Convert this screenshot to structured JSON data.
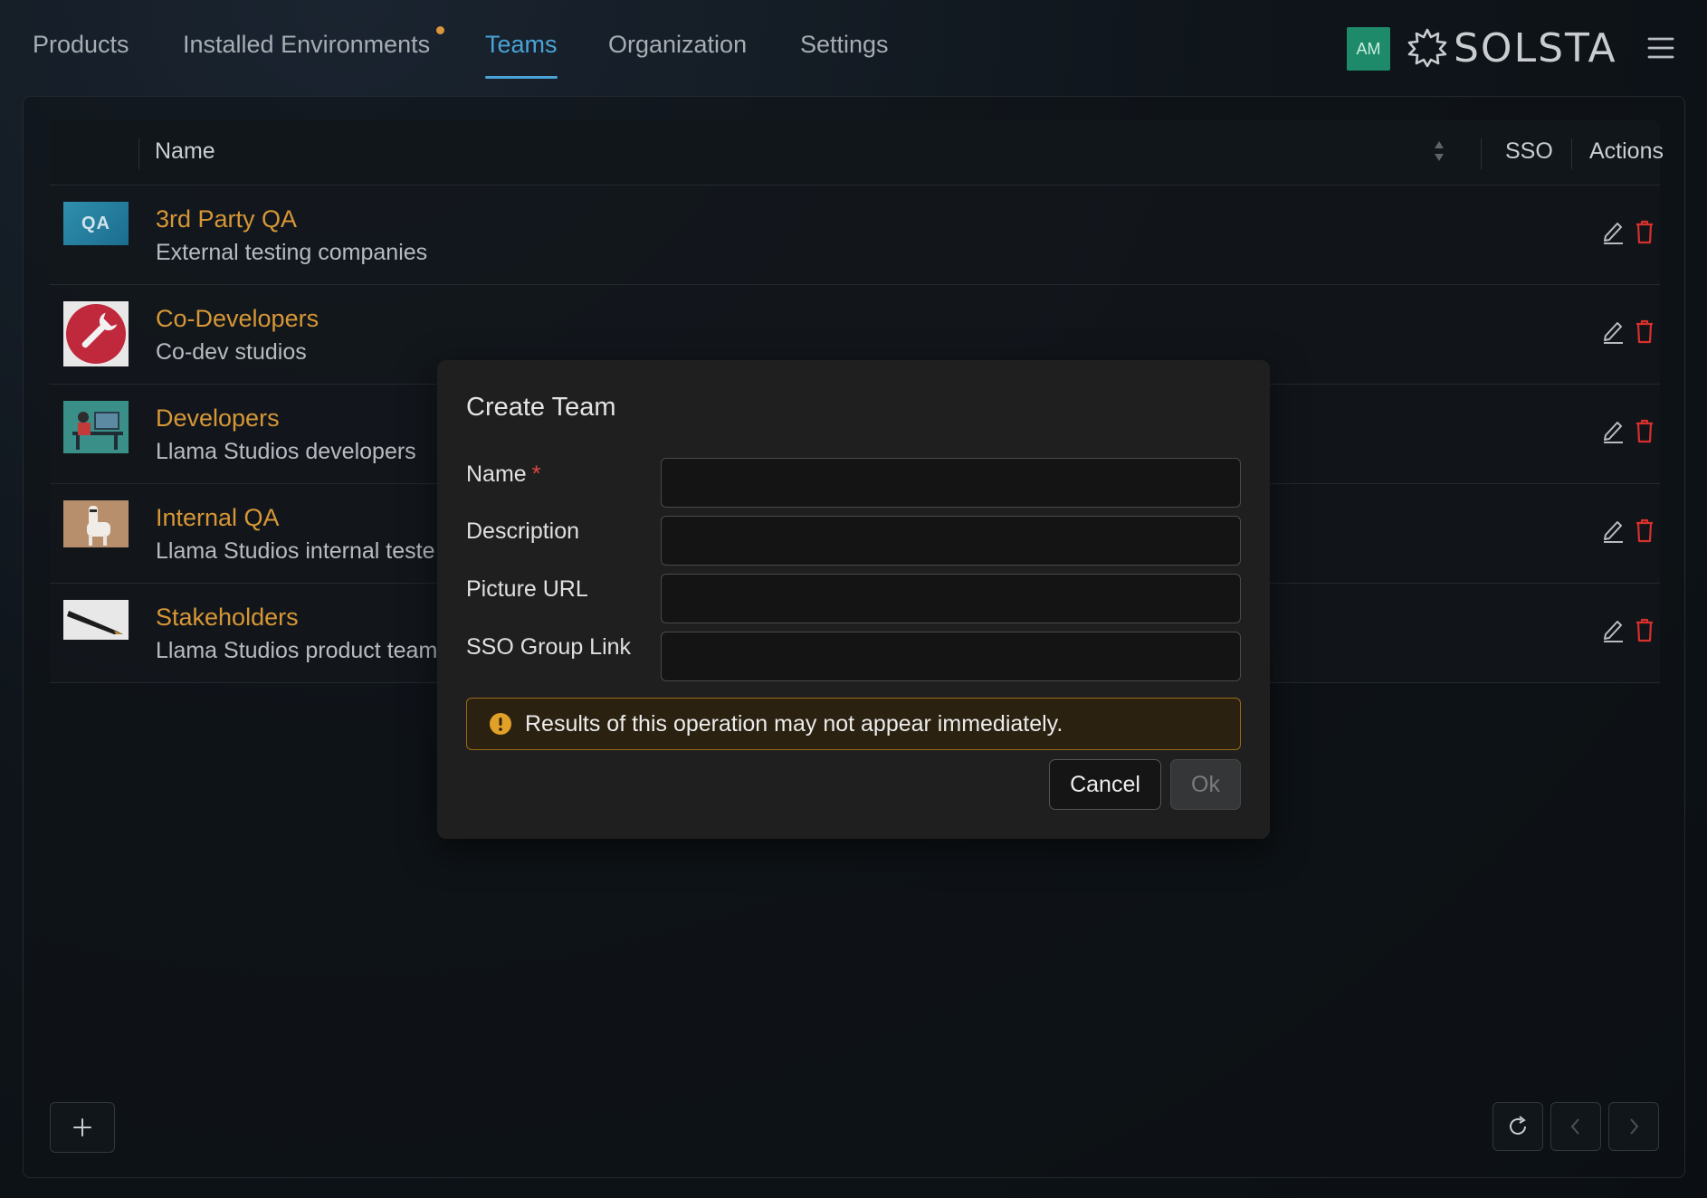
{
  "nav": {
    "tabs": [
      {
        "label": "Products"
      },
      {
        "label": "Installed Environments"
      },
      {
        "label": "Teams"
      },
      {
        "label": "Organization"
      },
      {
        "label": "Settings"
      }
    ],
    "active_tab": "Teams",
    "avatar_initials": "AM",
    "logo_text": "SOLSTA"
  },
  "table": {
    "columns": {
      "name": "Name",
      "sso": "SSO",
      "actions": "Actions"
    },
    "rows": [
      {
        "title": "3rd Party QA",
        "subtitle": "External testing companies",
        "thumb_text": "QA"
      },
      {
        "title": "Co-Developers",
        "subtitle": "Co-dev studios"
      },
      {
        "title": "Developers",
        "subtitle": "Llama Studios developers"
      },
      {
        "title": "Internal QA",
        "subtitle": "Llama Studios internal teste"
      },
      {
        "title": "Stakeholders",
        "subtitle": "Llama Studios product team"
      }
    ]
  },
  "modal": {
    "title": "Create Team",
    "fields": {
      "name": {
        "label": "Name",
        "required_mark": "*",
        "value": ""
      },
      "description": {
        "label": "Description",
        "value": ""
      },
      "picture_url": {
        "label": "Picture URL",
        "value": ""
      },
      "sso_group_link": {
        "label": "SSO Group Link",
        "value": ""
      }
    },
    "warning": "Results of this operation may not appear immediately.",
    "cancel_label": "Cancel",
    "ok_label": "Ok"
  },
  "colors": {
    "accent": "#4aa3d6",
    "team_link": "#d79736",
    "delete": "#d8302c",
    "warning_border": "#9a6a16",
    "avatar_bg": "#1e8a6a"
  }
}
